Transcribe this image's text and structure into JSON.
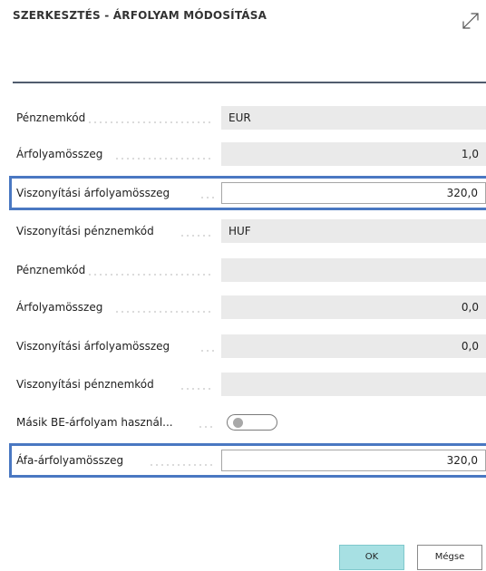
{
  "dialog": {
    "title": "SZERKESZTÉS - ÁRFOLYAM MÓDOSÍTÁSA"
  },
  "fields": [
    {
      "label": "Pénznemkód",
      "value": "EUR"
    },
    {
      "label": "Árfolyamösszeg",
      "value": "1,0"
    },
    {
      "label": "Viszonyítási árfolyamösszeg",
      "value": "320,0"
    },
    {
      "label": "Viszonyítási pénznemkód",
      "value": "HUF"
    },
    {
      "label": "Pénznemkód",
      "value": ""
    },
    {
      "label": "Árfolyamösszeg",
      "value": "0,0"
    },
    {
      "label": "Viszonyítási árfolyamösszeg",
      "value": "0,0"
    },
    {
      "label": "Viszonyítási pénznemkód",
      "value": ""
    },
    {
      "label": "Másik BE-árfolyam használ...",
      "value": false
    },
    {
      "label": "Áfa-árfolyamösszeg",
      "value": "320,0"
    }
  ],
  "buttons": {
    "ok": "OK",
    "cancel": "Mégse"
  },
  "colors": {
    "highlight_border": "#4a78c2",
    "ok_button": "#a7e0e3",
    "readonly_field": "#eaeaea"
  },
  "icons": {
    "expand": "expand-diagonal-arrows-icon"
  }
}
